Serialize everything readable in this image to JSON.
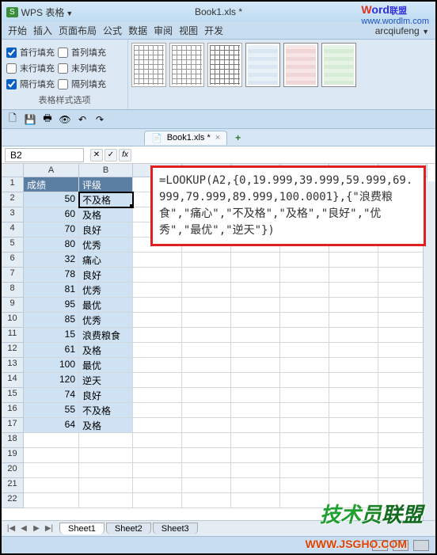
{
  "app": {
    "badge": "S",
    "menu_label": "WPS 表格",
    "doc_title": "Book1.xls *"
  },
  "brand": {
    "name_p1": "W",
    "name_p2": "ord",
    "name_p3": "联盟",
    "url": "www.wordlm.com"
  },
  "menu": {
    "items": [
      "开始",
      "插入",
      "页面布局",
      "公式",
      "数据",
      "审阅",
      "视图",
      "开发"
    ],
    "user": "arcqiufeng"
  },
  "ribbon": {
    "checkboxes": [
      {
        "label1": "首行填充",
        "checked1": true,
        "label2": "首列填充",
        "checked2": false
      },
      {
        "label1": "末行填充",
        "checked1": false,
        "label2": "末列填充",
        "checked2": false
      },
      {
        "label1": "隔行填充",
        "checked1": true,
        "label2": "隔列填充",
        "checked2": false
      }
    ],
    "group_label": "表格样式选项"
  },
  "qat_tooltip_chars": [
    "🗋",
    "💾",
    "🖶",
    "👁",
    "↶",
    "↷"
  ],
  "doc_tab": {
    "label": "Book1.xls *",
    "close": "×",
    "add": "+"
  },
  "namebox": "B2",
  "formula": "=LOOKUP(A2,{0,19.999,39.999,59.999,69.999,79.999,89.999,100.0001},{\"浪费粮食\",\"痛心\",\"不及格\",\"及格\",\"良好\",\"优秀\",\"最优\",\"逆天\"})",
  "columns": [
    "A",
    "B",
    "C",
    "D",
    "E",
    "F",
    "G",
    "H"
  ],
  "header_row": {
    "a": "成绩",
    "b": "评级"
  },
  "rows": [
    {
      "n": 1,
      "a": "成绩",
      "b": "评级",
      "is_header": true
    },
    {
      "n": 2,
      "a": "50",
      "b": "不及格",
      "selected": true
    },
    {
      "n": 3,
      "a": "60",
      "b": "及格"
    },
    {
      "n": 4,
      "a": "70",
      "b": "良好"
    },
    {
      "n": 5,
      "a": "80",
      "b": "优秀"
    },
    {
      "n": 6,
      "a": "32",
      "b": "痛心"
    },
    {
      "n": 7,
      "a": "78",
      "b": "良好"
    },
    {
      "n": 8,
      "a": "81",
      "b": "优秀"
    },
    {
      "n": 9,
      "a": "95",
      "b": "最优"
    },
    {
      "n": 10,
      "a": "85",
      "b": "优秀"
    },
    {
      "n": 11,
      "a": "15",
      "b": "浪费粮食"
    },
    {
      "n": 12,
      "a": "61",
      "b": "及格"
    },
    {
      "n": 13,
      "a": "100",
      "b": "最优"
    },
    {
      "n": 14,
      "a": "120",
      "b": "逆天"
    },
    {
      "n": 15,
      "a": "74",
      "b": "良好"
    },
    {
      "n": 16,
      "a": "55",
      "b": "不及格"
    },
    {
      "n": 17,
      "a": "64",
      "b": "及格"
    },
    {
      "n": 18,
      "a": "",
      "b": ""
    },
    {
      "n": 19,
      "a": "",
      "b": ""
    },
    {
      "n": 20,
      "a": "",
      "b": ""
    },
    {
      "n": 21,
      "a": "",
      "b": ""
    },
    {
      "n": 22,
      "a": "",
      "b": ""
    }
  ],
  "sheets": [
    "Sheet1",
    "Sheet2",
    "Sheet3"
  ],
  "nav_glyphs": [
    "|◀",
    "◀",
    "▶",
    "▶|"
  ],
  "watermark1": "技术员联盟",
  "watermark2": "WWW.JSGHO.COM"
}
